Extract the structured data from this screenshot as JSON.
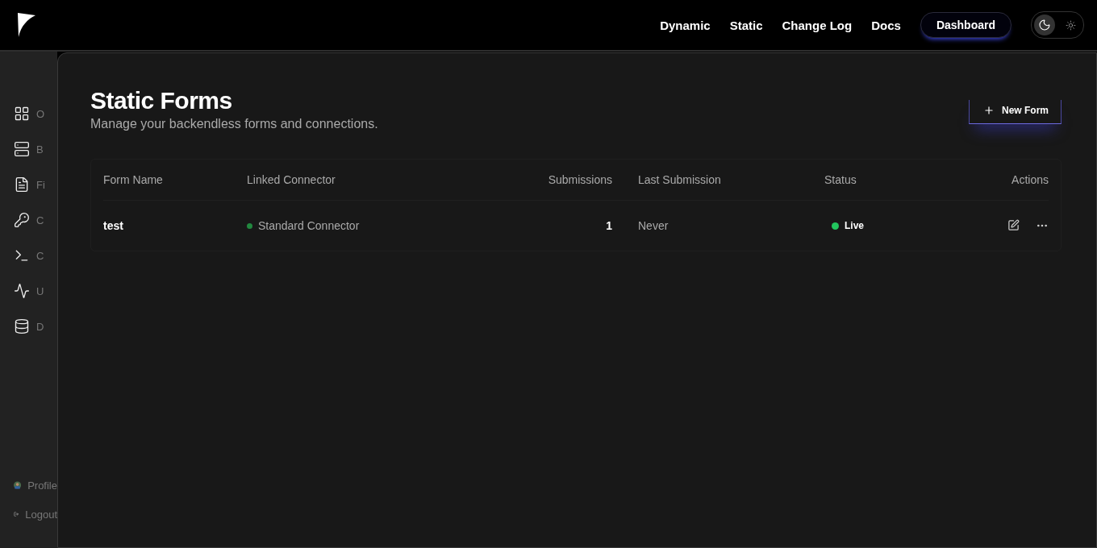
{
  "nav": {
    "links": [
      {
        "label": "Dynamic"
      },
      {
        "label": "Static"
      },
      {
        "label": "Change Log"
      },
      {
        "label": "Docs"
      }
    ],
    "dashboard_button": "Dashboard",
    "theme_toggle": [
      {
        "kind": "dark",
        "selected": true
      },
      {
        "kind": "light",
        "selected": false
      }
    ]
  },
  "sidebar": {
    "items": [
      {
        "kind": "grid",
        "label": "O"
      },
      {
        "kind": "server",
        "label": "B"
      },
      {
        "kind": "file",
        "label": "Fi"
      },
      {
        "kind": "key",
        "label": "C"
      },
      {
        "kind": "terminal",
        "label": "C"
      },
      {
        "kind": "activity",
        "label": "U"
      },
      {
        "kind": "database",
        "label": "D"
      }
    ],
    "footer": [
      {
        "kind": "avatar",
        "label": "Profile"
      },
      {
        "kind": "logout",
        "label": "Logout"
      }
    ]
  },
  "page": {
    "title": "Static Forms",
    "subtitle": "Manage your backendless forms and connections.",
    "new_button": "New Form"
  },
  "table": {
    "columns": [
      "Form Name",
      "Linked Connector",
      "Submissions",
      "Last Submission",
      "Status",
      "Actions"
    ],
    "rows": [
      {
        "name": "test",
        "connector": {
          "label": "Standard Connector",
          "color": "#22883f"
        },
        "submissions": "1",
        "last_submission": "Never",
        "status": {
          "label": "Live",
          "color": "#22c55e"
        }
      }
    ]
  }
}
